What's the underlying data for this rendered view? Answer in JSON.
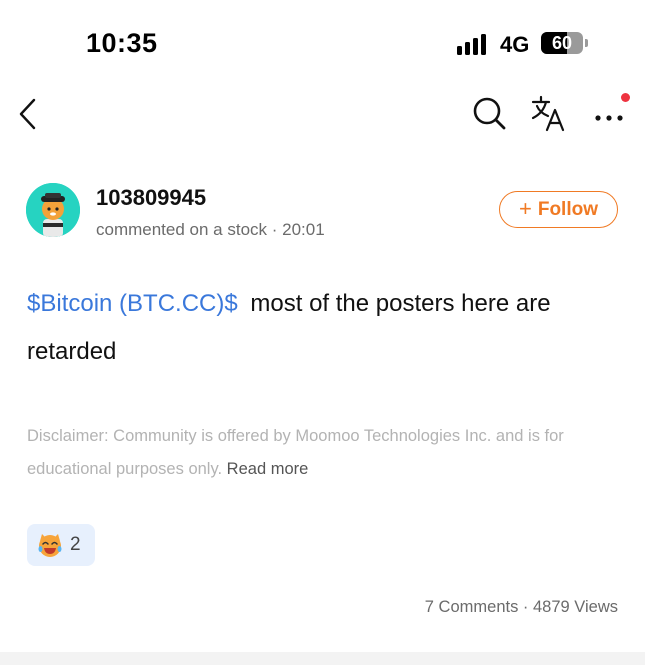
{
  "status_bar": {
    "time": "10:35",
    "network": "4G",
    "battery": "60"
  },
  "nav": {
    "back_icon": "chevron-left-icon",
    "search_icon": "search-icon",
    "translate_icon": "translate-icon",
    "more_icon": "more-horizontal-icon",
    "notification_dot_color": "#ee3340"
  },
  "author": {
    "username": "103809945",
    "meta": "commented on a stock · 20:01",
    "follow_label": "Follow",
    "accent_color": "#f07a24"
  },
  "post": {
    "ticker": "$Bitcoin (BTC.CC)$",
    "text": "most of the posters here are retarded",
    "ticker_color": "#3a78db"
  },
  "disclaimer": {
    "text": "Disclaimer: Community is offered by Moomoo Technologies Inc. and is for educational purposes only.",
    "read_more": "Read more"
  },
  "reaction": {
    "emoji": "laughing-face-icon",
    "count": "2"
  },
  "stats": {
    "text": "7 Comments · 4879 Views"
  }
}
